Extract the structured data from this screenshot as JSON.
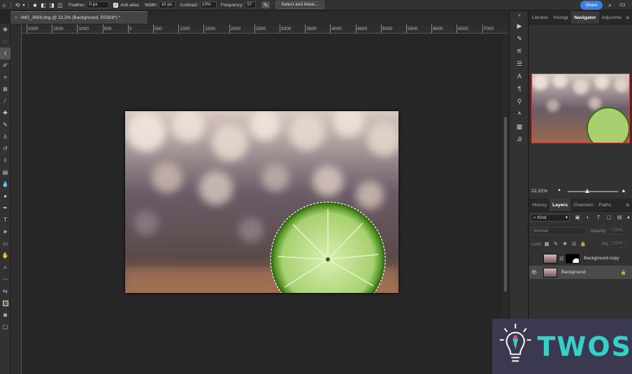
{
  "options_bar": {
    "feather_label": "Feather:",
    "feather_value": "0 px",
    "anti_alias_label": "Anti-alias",
    "width_label": "Width:",
    "width_value": "10 px",
    "contrast_label": "Contrast:",
    "contrast_value": "10%",
    "frequency_label": "Frequency:",
    "frequency_value": "57",
    "select_mask_label": "Select and Mask...",
    "share_label": "Share"
  },
  "document": {
    "tab_title": "IMG_3659.dng @ 22,3% (Background, RGB/8*) *",
    "close_glyph": "×"
  },
  "ruler": {
    "ticks": [
      "2000",
      "1500",
      "1000",
      "500",
      "0",
      "500",
      "1000",
      "1500",
      "2000",
      "2500",
      "3000",
      "3500",
      "4000",
      "4500",
      "5000",
      "5500",
      "6000",
      "6500",
      "7000"
    ]
  },
  "panels": {
    "top_tabs": [
      "Librarie",
      "Histogr",
      "Navigator",
      "Adjustme"
    ],
    "top_active": 2,
    "zoom_value": "22,31%",
    "layer_tabs": [
      "History",
      "Layers",
      "Channels",
      "Paths"
    ],
    "layer_active": 1,
    "filter_kind": "Kind",
    "blend_mode": "Normal",
    "opacity_label": "Opacity:",
    "opacity_value": "100%",
    "lock_label": "Lock:",
    "fill_label": "Fill:",
    "fill_value": "100%",
    "layers": [
      {
        "name": "Background copy",
        "visible": false
      },
      {
        "name": "Background",
        "visible": true
      }
    ]
  },
  "watermark": {
    "text": "TWOS"
  },
  "colors": {
    "accent": "#3b7ee6",
    "watermark_text": "#35d1c8",
    "watermark_bg": "#3b3950"
  }
}
